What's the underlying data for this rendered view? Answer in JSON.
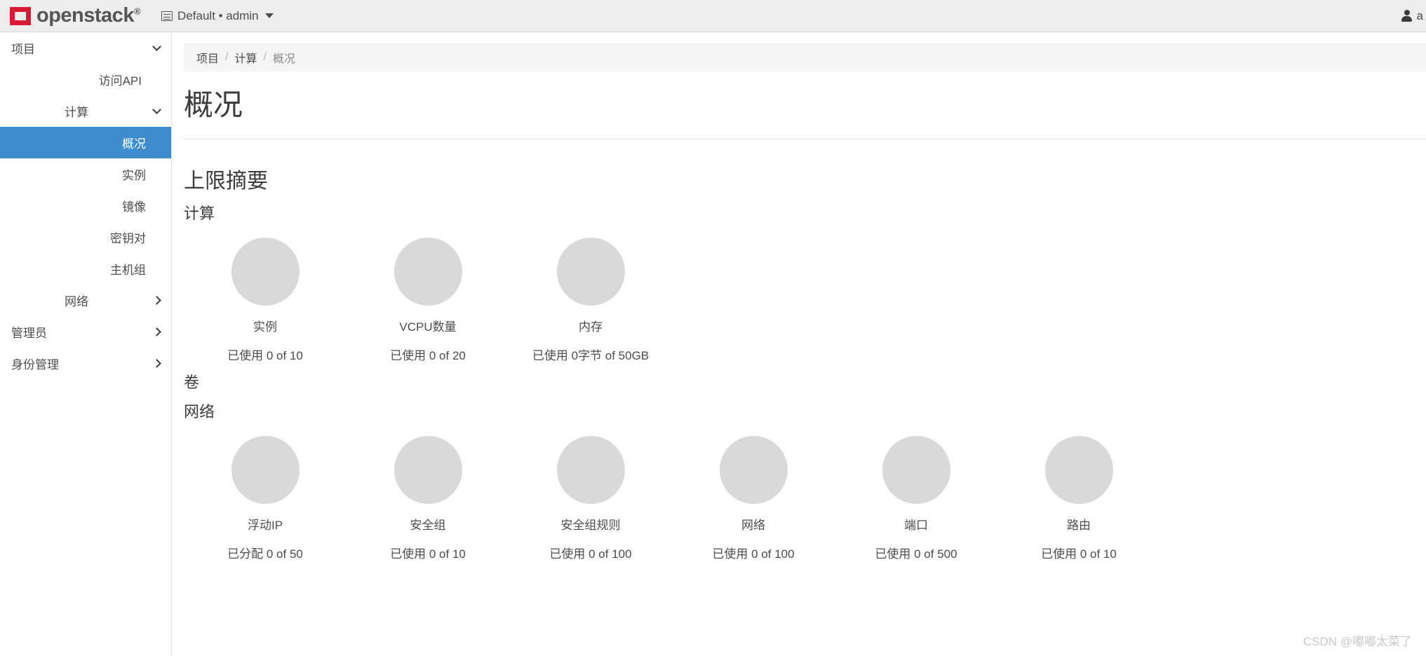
{
  "navbar": {
    "brand_text": "openstack",
    "brand_reg": "®",
    "context_label": "Default • admin",
    "user_label": "a"
  },
  "sidebar": {
    "items": [
      {
        "label": "项目",
        "level": 0,
        "icon": "chevron-down-icon",
        "active": false
      },
      {
        "label": "访问API",
        "level": 1,
        "icon": "",
        "active": false
      },
      {
        "label": "计算",
        "level": 1,
        "icon": "chevron-down-icon",
        "active": false
      },
      {
        "label": "概况",
        "level": 2,
        "icon": "",
        "active": true
      },
      {
        "label": "实例",
        "level": 2,
        "icon": "",
        "active": false
      },
      {
        "label": "镜像",
        "level": 2,
        "icon": "",
        "active": false
      },
      {
        "label": "密钥对",
        "level": 2,
        "icon": "",
        "active": false
      },
      {
        "label": "主机组",
        "level": 2,
        "icon": "",
        "active": false
      },
      {
        "label": "网络",
        "level": 1,
        "icon": "chevron-right-icon",
        "active": false
      },
      {
        "label": "管理员",
        "level": 0,
        "icon": "chevron-right-icon",
        "active": false
      },
      {
        "label": "身份管理",
        "level": 0,
        "icon": "chevron-right-icon",
        "active": false
      }
    ]
  },
  "breadcrumb": {
    "items": [
      "项目",
      "计算",
      "概况"
    ],
    "separator": "/"
  },
  "page": {
    "title": "概况",
    "section_title": "上限摘要"
  },
  "sections": [
    {
      "heading": "计算",
      "items": [
        {
          "label": "实例",
          "usage": "已使用 0 of 10"
        },
        {
          "label": "VCPU数量",
          "usage": "已使用 0 of 20"
        },
        {
          "label": "内存",
          "usage": "已使用 0字节 of 50GB"
        }
      ]
    },
    {
      "heading": "卷",
      "items": []
    },
    {
      "heading": "网络",
      "items": [
        {
          "label": "浮动IP",
          "usage": "已分配 0 of 50"
        },
        {
          "label": "安全组",
          "usage": "已使用 0 of 10"
        },
        {
          "label": "安全组规则",
          "usage": "已使用 0 of 100"
        },
        {
          "label": "网络",
          "usage": "已使用 0 of 100"
        },
        {
          "label": "端口",
          "usage": "已使用 0 of 500"
        },
        {
          "label": "路由",
          "usage": "已使用 0 of 10"
        }
      ]
    }
  ],
  "watermark": "CSDN @嘟嘟太菜了",
  "colors": {
    "brand_red": "#da1a32",
    "active_blue": "#3e8ccc",
    "navbar_bg": "#ededed",
    "circle_gray": "#d9d9d9"
  }
}
